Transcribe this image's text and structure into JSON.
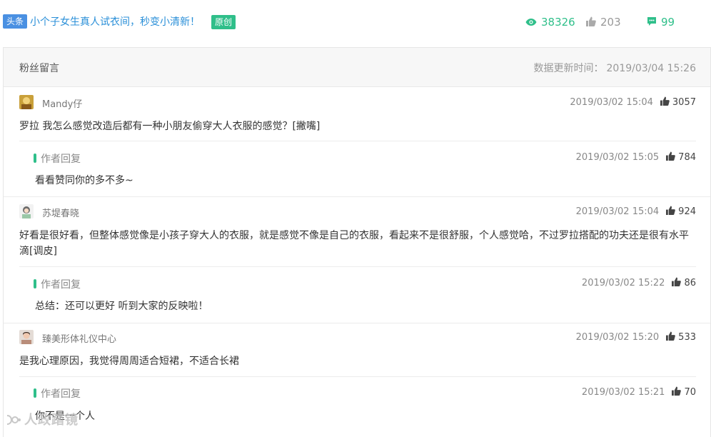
{
  "article": {
    "source_badge": "头条",
    "title": "小个子女生真人试衣间，秒变小清新！",
    "original_badge": "原创",
    "views": "38326",
    "likes": "203",
    "comments": "99"
  },
  "panel": {
    "title": "粉丝留言",
    "update_label": "数据更新时间：",
    "update_time": "2019/03/04 15:26"
  },
  "comments": [
    {
      "user": "Mandy仔",
      "time": "2019/03/02 15:04",
      "likes": "3057",
      "text": "罗拉 我怎么感觉改造后都有一种小朋友偷穿大人衣服的感觉？[撇嘴]",
      "reply": {
        "label": "作者回复",
        "time": "2019/03/02 15:05",
        "likes": "784",
        "text": "看看赞同你的多不多~"
      }
    },
    {
      "user": "苏堤春晓",
      "time": "2019/03/02 15:04",
      "likes": "924",
      "text": "好看是很好看，但整体感觉像是小孩子穿大人的衣服，就是感觉不像是自己的衣服，看起来不是很舒服，个人感觉哈，不过罗拉搭配的功夫还是很有水平滴[调皮]",
      "reply": {
        "label": "作者回复",
        "time": "2019/03/02 15:22",
        "likes": "86",
        "text": "总结：还可以更好 听到大家的反映啦！"
      }
    },
    {
      "user": "臻美形体礼仪中心",
      "time": "2019/03/02 15:20",
      "likes": "533",
      "text": "是我心理原因，我觉得周周适合短裙，不适合长裙",
      "reply": {
        "label": "作者回复",
        "time": "2019/03/02 15:21",
        "likes": "70",
        "text": "你不是一个人"
      }
    }
  ],
  "watermark": "人政踏镜",
  "colors": {
    "accent": "#2fbf8a",
    "link": "#2a8fd8",
    "badge": "#4a90e2"
  },
  "icons": {
    "views": "eye-icon",
    "likes": "thumbs-up-icon",
    "comments": "comment-icon"
  }
}
